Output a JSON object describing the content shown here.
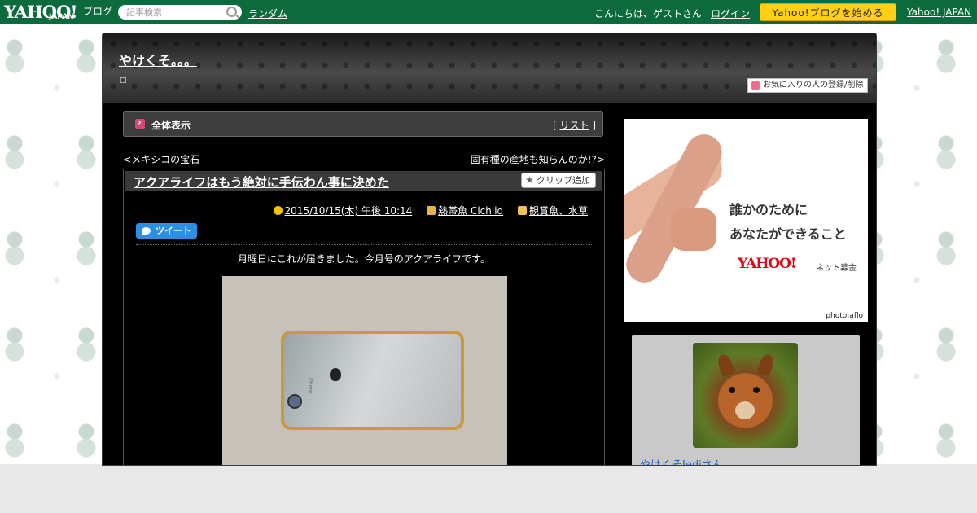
{
  "topbar": {
    "logo": "YAHOO!",
    "logo_sub": "JAPAN",
    "logo_blog": "ブログ",
    "search_placeholder": "記事検索",
    "random": "ランダム",
    "greeting": "こんにちは、ゲストさん",
    "login": "ログイン",
    "start_blog": "Yahoo!ブログを始める",
    "yahoo_japan": "Yahoo! JAPAN"
  },
  "blog": {
    "title": "やけくそ。。。",
    "subtitle": "□",
    "favorite_button": "お気に入りの人の登録/削除"
  },
  "view_bar": {
    "label": "全体表示",
    "list_prefix": "[ ",
    "list_link": "リスト",
    "list_suffix": " ]"
  },
  "nav": {
    "prev_symbol": "<",
    "prev": "メキシコの宝石",
    "next": "固有種の産地も知らんのか!?",
    "next_symbol": ">"
  },
  "article": {
    "title": "アクアライフはもう絶対に手伝わん事に決めた",
    "clip_button": "クリップ追加",
    "date": "2015/10/15(木) 午後 10:14",
    "category": "熱帯魚 Cichlid",
    "tags": "観賞魚、水草",
    "tweet_button": "ツイート",
    "body": "月曜日にこれが届きました。今月号のアクアライフです。",
    "phone_text": "iPhone"
  },
  "ad": {
    "line1": "誰かのために",
    "line2": "あなたができること",
    "brand": "YAHOO!",
    "brand_sub": "ネット募金",
    "credit": "photo:aflo"
  },
  "profile": {
    "name": "やけくそJediさん"
  },
  "icons": {
    "search": "search-icon",
    "heart": "heart-icon",
    "arrow": "arrow-right-icon",
    "star": "star-icon",
    "clock": "clock-icon",
    "book": "book-icon",
    "folder": "folder-icon",
    "bird": "twitter-bird-icon"
  },
  "colors": {
    "topbar": "#0c6b3c",
    "start_button": "#ffcf13",
    "tweet": "#2d8ee6",
    "profile_link": "#1a62c9"
  }
}
